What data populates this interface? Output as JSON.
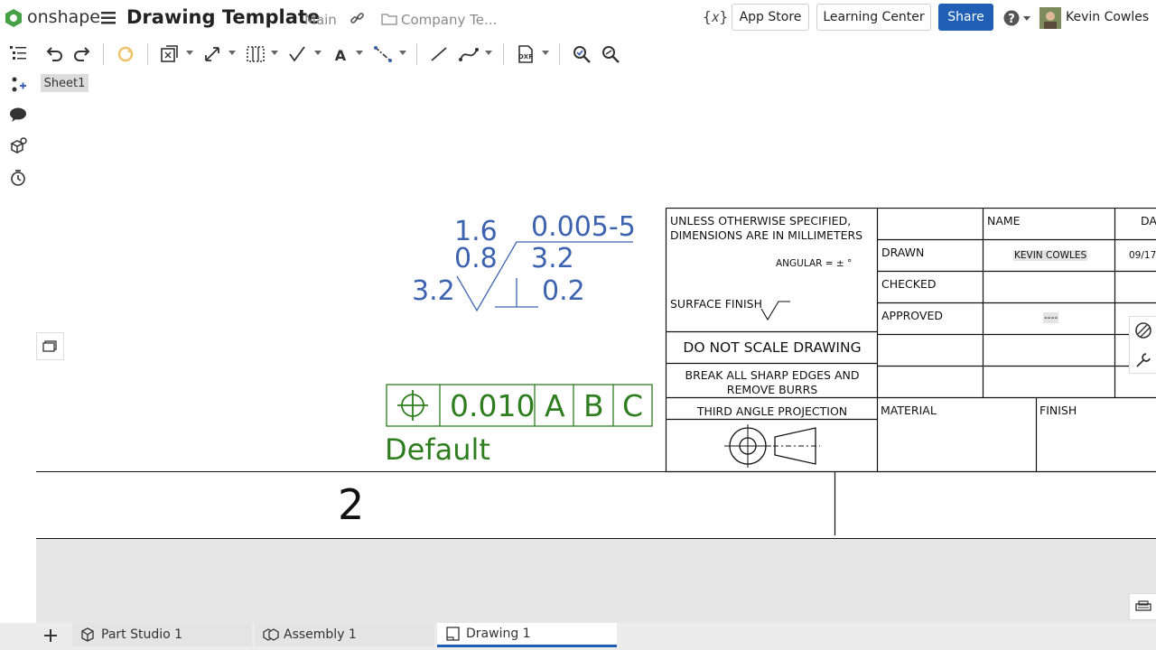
{
  "header": {
    "brand": "onshape",
    "title": "Drawing Template",
    "branch": "Main",
    "folder": "Company Te...",
    "app_store": "App Store",
    "learning_center": "Learning Center",
    "share": "Share",
    "user": "Kevin Cowles"
  },
  "sheet": {
    "tab_label": "Sheet1"
  },
  "surface_symbol": {
    "top_left": "1.6",
    "mid_left": "0.8",
    "bottom_left": "3.2",
    "top_right": "0.005-5",
    "mid_right": "3.2",
    "bottom_right": "0.2"
  },
  "fcf": {
    "tolerance": "0.010",
    "datum_a": "A",
    "datum_b": "B",
    "datum_c": "C",
    "label": "Default"
  },
  "title_block": {
    "unless_line1": "UNLESS OTHERWISE SPECIFIED,",
    "unless_line2": "DIMENSIONS ARE IN MILLIMETERS",
    "angular": "ANGULAR = ± °",
    "surface_finish": "SURFACE FINISH",
    "do_not_scale": "DO NOT SCALE DRAWING",
    "break_edges_1": "BREAK ALL SHARP EDGES AND",
    "break_edges_2": "REMOVE BURRS",
    "third_angle": "THIRD ANGLE PROJECTION",
    "name_header": "NAME",
    "date_header": "DA",
    "drawn": "DRAWN",
    "drawn_name": "KEVIN COWLES",
    "drawn_date": "09/17",
    "checked": "CHECKED",
    "approved": "APPROVED",
    "approved_name": "----",
    "material": "MATERIAL",
    "finish": "FINISH"
  },
  "bottom_row": {
    "number": "2"
  },
  "tabs": [
    {
      "label": "Part Studio 1"
    },
    {
      "label": "Assembly 1"
    },
    {
      "label": "Drawing 1"
    }
  ],
  "colors": {
    "accent": "#1f5fb5",
    "annotation_blue": "#3d63b0",
    "annotation_green": "#2e7d1e"
  }
}
